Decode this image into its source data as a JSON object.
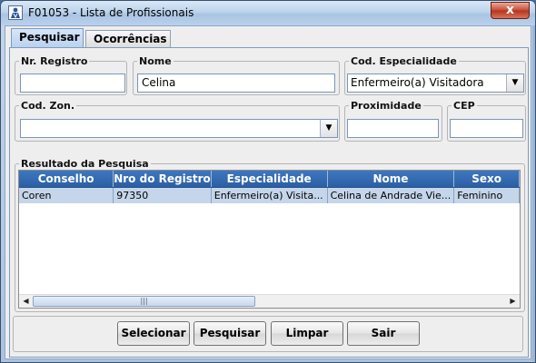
{
  "window": {
    "title": "F01053 - Lista de Profissionais",
    "close_glyph": "x"
  },
  "tabs": [
    {
      "label": "Pesquisar",
      "active": true
    },
    {
      "label": "Ocorrências",
      "active": false
    }
  ],
  "filters": {
    "nr_registro": {
      "label": "Nr. Registro",
      "value": ""
    },
    "nome": {
      "label": "Nome",
      "value": "Celina"
    },
    "cod_especialidade": {
      "label": "Cod. Especialidade",
      "value": "Enfermeiro(a) Visitadora"
    },
    "cod_zon": {
      "label": "Cod. Zon.",
      "value": ""
    },
    "proximidade": {
      "label": "Proximidade",
      "value": ""
    },
    "cep": {
      "label": "CEP",
      "value": ""
    }
  },
  "results": {
    "title": "Resultado da Pesquisa",
    "columns": [
      "Conselho",
      "Nro do Registro",
      "Especialidade",
      "Nome",
      "Sexo"
    ],
    "rows": [
      [
        "Coren",
        "97350",
        "Enfermeiro(a) Visita...",
        "Celina de Andrade Vie...",
        "Feminino"
      ]
    ]
  },
  "buttons": {
    "selecionar": "Selecionar",
    "pesquisar": "Pesquisar",
    "limpar": "Limpar",
    "sair": "Sair"
  },
  "icons": {
    "combo_arrow": "▼",
    "scroll_left": "◀",
    "scroll_right": "▶",
    "scroll_grip": "|||"
  },
  "colors": {
    "header_bg": "#2f66ab",
    "selected_row": "#c5d6ea",
    "accent": "#7d9ac2"
  }
}
